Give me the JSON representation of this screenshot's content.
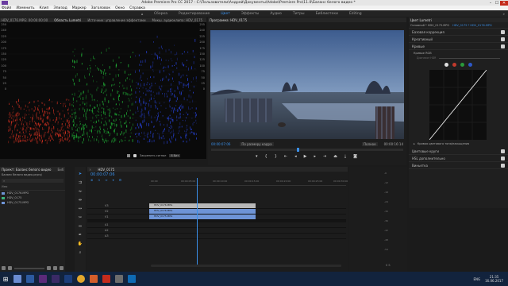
{
  "app_title": "Adobe Premiere Pro CC 2017 - C:\\Пользователи\\Андрей\\Документы\\Adobe\\Premiere Pro\\11.0\\Баланс белого видео *",
  "menu": [
    "Файл",
    "Изменить",
    "Клип",
    "Эпизод",
    "Маркер",
    "Заголовок",
    "Окно",
    "Справка"
  ],
  "workspaces": [
    {
      "label": "Сборка",
      "active": false
    },
    {
      "label": "Редактирование",
      "active": false
    },
    {
      "label": "Цвет",
      "active": true
    },
    {
      "label": "Эффекты",
      "active": false
    },
    {
      "label": "Аудио",
      "active": false
    },
    {
      "label": "Титры",
      "active": false
    },
    {
      "label": "Библиотеки",
      "active": false
    },
    {
      "label": "Editing",
      "active": false
    }
  ],
  "scopes": {
    "tabs": [
      "HDV_0176.MPG: 00:00:00:00",
      "Область Lumetri",
      "Источник: управление эффектами",
      "Микш. аудиоклипа: HDV_0175"
    ],
    "active_tab": 1,
    "scale_left": [
      "250",
      "240",
      "225",
      "200",
      "175",
      "150",
      "125",
      "100",
      "75",
      "50",
      "25",
      "0"
    ],
    "scale_right": [
      "255",
      "240",
      "225",
      "200",
      "175",
      "150",
      "125",
      "100",
      "75",
      "50",
      "25",
      "0"
    ],
    "bit_depth": "8 бит",
    "clamp_label": "Закрепить сигнал",
    "colors": {
      "red": "#d93222",
      "green": "#22c03a",
      "blue": "#2845e6"
    }
  },
  "monitor": {
    "title": "Программа: HDV_0175",
    "timecode": "00:00:07:06",
    "duration": "00:00:16:14",
    "fit": "По размеру кадра",
    "quality": "Полное"
  },
  "lumetri": {
    "header": "Цвет Lumetri",
    "sub": "Основной * HDV_0175.MPG",
    "sub_active": "HDV_0175 * HDV_0176.MPG",
    "sections": [
      "Базовая коррекция",
      "Креативный",
      "Кривые"
    ],
    "rgb_curves": "Кривые RGB",
    "hdr_range": "Диапазон HDR",
    "hue_sat": "Кривая цветового тона/насыщения",
    "wheels": "Цветовые круги",
    "hsl": "HSL дополнительно",
    "vignette": "Виньетка"
  },
  "project": {
    "title": "Проект: Баланс белого видео",
    "tab2": "Биб",
    "file": "Баланс белого видео.prproj",
    "items_header": "Имя",
    "items": [
      "HDV_0176.MPG",
      "HDV_0175",
      "HDV_0175.MPG"
    ]
  },
  "timeline": {
    "title": "HDV_0175",
    "timecode": "00:00:07:06",
    "ruler": [
      "00:00",
      "00:00:05:00",
      "00:00:10:00",
      "00:00:15:00",
      "00:00:20:00",
      "00:00:25:00",
      "00:00:30:00"
    ],
    "tracks": [
      "V3",
      "V2",
      "V1",
      "A1",
      "A2",
      "A3"
    ],
    "clips": [
      {
        "label": "HDV_0176.MPG",
        "track": "V3",
        "color": "#b8b8b8"
      },
      {
        "label": "HDV_0176.MPG",
        "track": "V2",
        "color": "#6e94d6"
      },
      {
        "label": "HDV_0175.MPG",
        "track": "V1",
        "color": "#6e94d6"
      }
    ]
  },
  "audio_meter": {
    "scale": [
      "-6",
      "-12",
      "-18",
      "-24",
      "-30",
      "-36",
      "-42",
      "-48",
      "-54"
    ],
    "bottom": "S S"
  },
  "taskbar": {
    "lang": "ENG",
    "time": "21:35",
    "date": "16.06.2017"
  }
}
